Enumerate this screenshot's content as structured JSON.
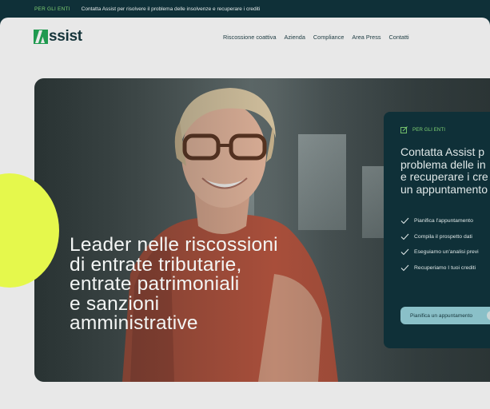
{
  "topbar": {
    "tag": "PER GLI ENTI",
    "message": "Contatta Assist per risolvere il problema delle insolvenze e recuperare i crediti"
  },
  "header": {
    "logo_text": "ssist",
    "nav": [
      "Riscossione coattiva",
      "Azienda",
      "Compliance",
      "Area Press",
      "Contatti"
    ]
  },
  "hero": {
    "headline": [
      "Leader nelle riscossioni",
      "di entrate tributarie,",
      "entrate patrimoniali",
      "e sanzioni",
      "amministrative"
    ]
  },
  "card": {
    "tag": "PER GLI ENTI",
    "title": [
      "Contatta Assist p",
      "problema delle in",
      "e recuperare i cre",
      "un appuntamento"
    ],
    "steps": [
      "Pianifica l'appuntamento",
      "Compila il prospetto dati",
      "Eseguiamo un'analisi previ",
      "Recuperiamo I tuoi crediti"
    ],
    "cta": "Pianifica un appuntamento"
  },
  "colors": {
    "dark": "#0f3038",
    "accent_green": "#1f9a4f",
    "lime": "#e5f84c",
    "cta": "#8ac0c8"
  }
}
